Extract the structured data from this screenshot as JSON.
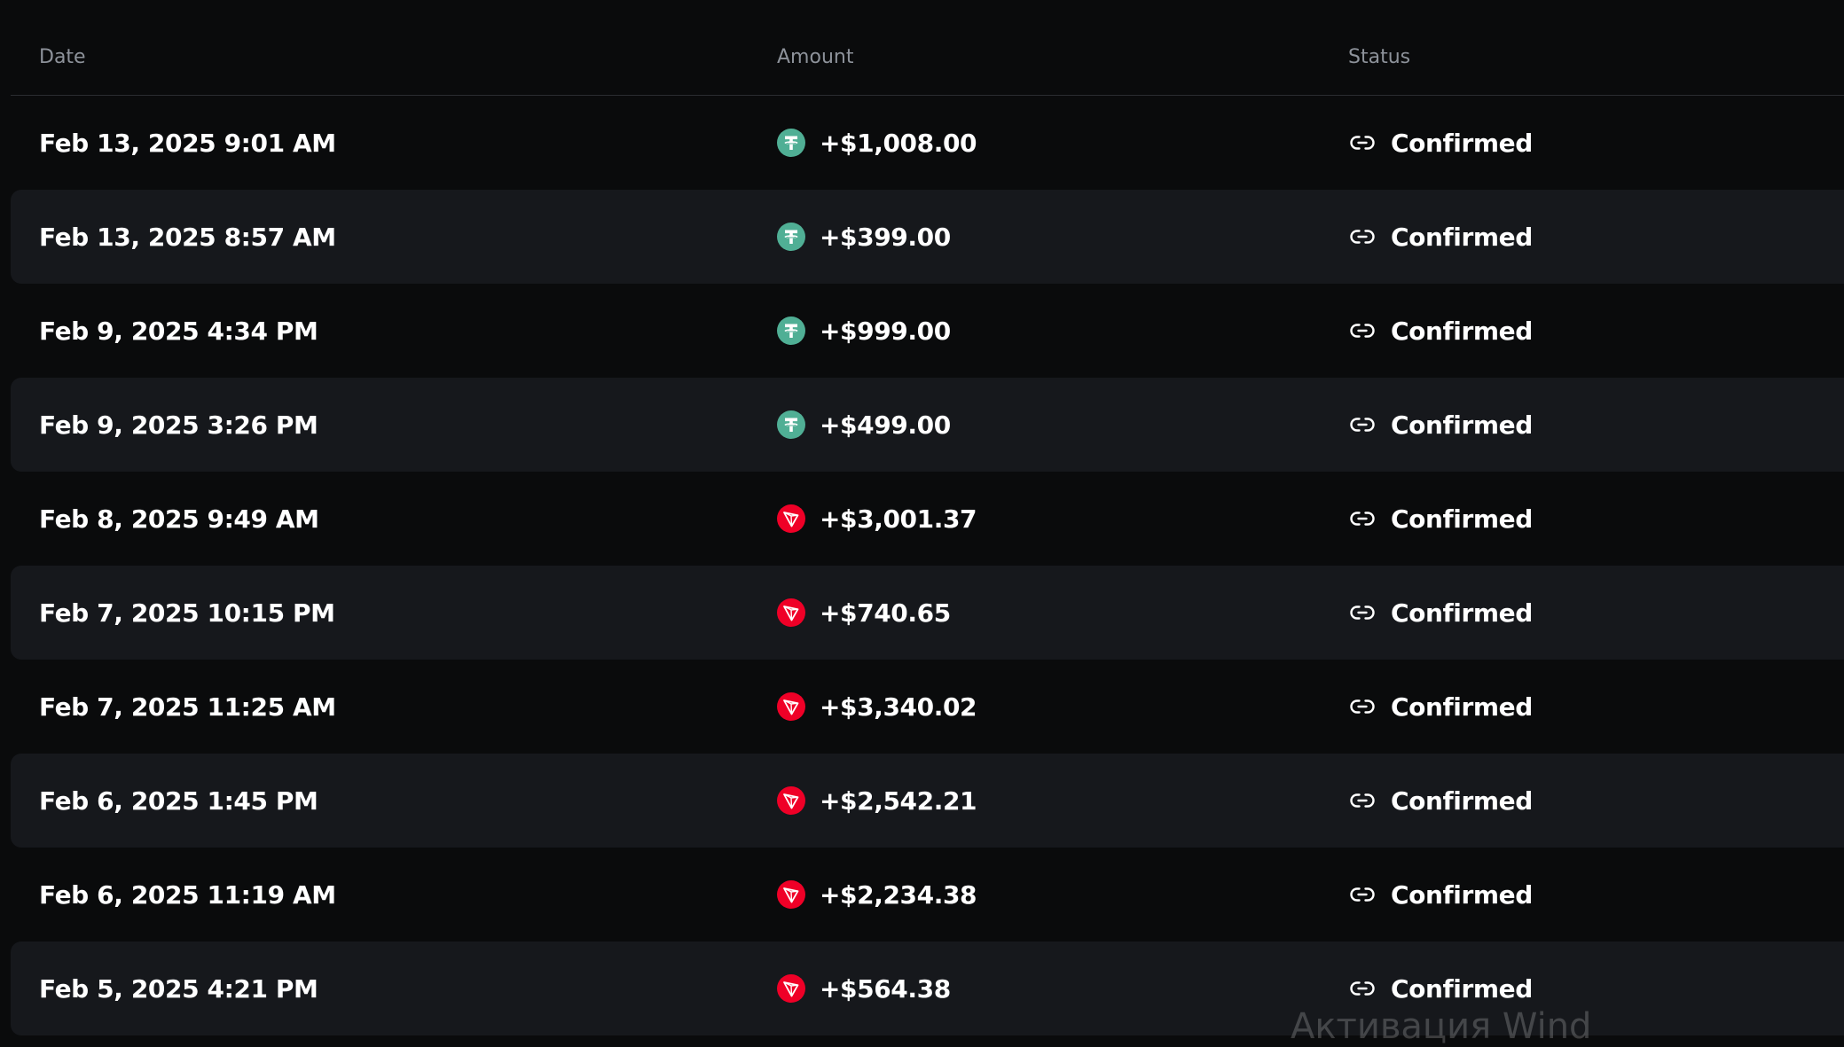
{
  "table": {
    "headers": {
      "date": "Date",
      "amount": "Amount",
      "status": "Status"
    },
    "rows": [
      {
        "date": "Feb 13, 2025 9:01 AM",
        "coin": "usdt-icon",
        "amount": "+$1,008.00",
        "status": "Confirmed"
      },
      {
        "date": "Feb 13, 2025 8:57 AM",
        "coin": "usdt-icon",
        "amount": "+$399.00",
        "status": "Confirmed"
      },
      {
        "date": "Feb 9, 2025 4:34 PM",
        "coin": "usdt-icon",
        "amount": "+$999.00",
        "status": "Confirmed"
      },
      {
        "date": "Feb 9, 2025 3:26 PM",
        "coin": "usdt-icon",
        "amount": "+$499.00",
        "status": "Confirmed"
      },
      {
        "date": "Feb 8, 2025 9:49 AM",
        "coin": "trx-icon",
        "amount": "+$3,001.37",
        "status": "Confirmed"
      },
      {
        "date": "Feb 7, 2025 10:15 PM",
        "coin": "trx-icon",
        "amount": "+$740.65",
        "status": "Confirmed"
      },
      {
        "date": "Feb 7, 2025 11:25 AM",
        "coin": "trx-icon",
        "amount": "+$3,340.02",
        "status": "Confirmed"
      },
      {
        "date": "Feb 6, 2025 1:45 PM",
        "coin": "trx-icon",
        "amount": "+$2,542.21",
        "status": "Confirmed"
      },
      {
        "date": "Feb 6, 2025 11:19 AM",
        "coin": "trx-icon",
        "amount": "+$2,234.38",
        "status": "Confirmed"
      },
      {
        "date": "Feb 5, 2025 4:21 PM",
        "coin": "trx-icon",
        "amount": "+$564.38",
        "status": "Confirmed"
      }
    ]
  },
  "colors": {
    "background": "#0a0b0c",
    "row_alt": "#16181c",
    "header_text": "#8d929a",
    "usdt": "#50af95",
    "trx": "#ef0027"
  },
  "watermark": "Активация Wind"
}
